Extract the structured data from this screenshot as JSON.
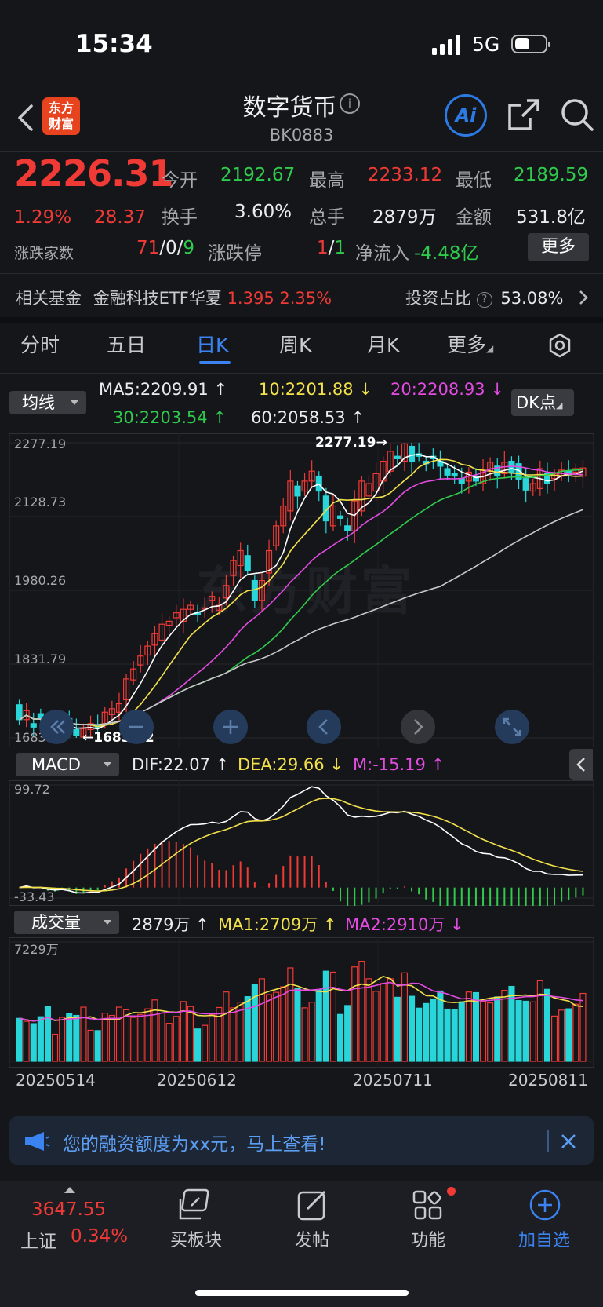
{
  "status_bar": {
    "time": "15:34",
    "network": "5G"
  },
  "header": {
    "logo_text": "东方\n财富",
    "title": "数字货币",
    "code": "BK0883",
    "ai_label": "Ai"
  },
  "quote": {
    "price": "2226.31",
    "change_pct": "1.29%",
    "change": "28.37",
    "open_label": "今开",
    "open": "2192.67",
    "high_label": "最高",
    "high": "2233.12",
    "low_label": "最低",
    "low": "2189.59",
    "turnover_label": "换手",
    "turnover": "3.60%",
    "volume_label": "总手",
    "volume": "2879万",
    "amount_label": "金额",
    "amount": "531.8亿",
    "breadth_label": "涨跌家数",
    "breadth_up": "71",
    "breadth_sep1": "/",
    "breadth_flat": "0",
    "breadth_sep2": "/",
    "breadth_down": "9",
    "limit_label": "涨跌停",
    "limit_up": "1",
    "limit_sep": "/",
    "limit_down": "1",
    "netflow_label": "净流入",
    "netflow": "-4.48亿",
    "more_label": "更多"
  },
  "fund": {
    "label": "相关基金",
    "name": "金融科技ETF华夏",
    "price": "1.395",
    "pct": "2.35%",
    "ratio_label": "投资占比",
    "ratio": "53.08%"
  },
  "tabs": [
    "分时",
    "五日",
    "日K",
    "周K",
    "月K",
    "更多"
  ],
  "ma_panel": {
    "selector": "均线",
    "ma5": "MA5:2209.91",
    "ma10": "10:2201.88",
    "ma20": "20:2208.93",
    "ma30": "30:2203.54",
    "ma60": "60:2058.53",
    "dk_label": "DK点"
  },
  "chart_data": [
    {
      "type": "candlestick",
      "title": "日K",
      "y_ticks": [
        "2277.19",
        "2128.73",
        "1980.26",
        "1831.79",
        "1683.32"
      ],
      "ylim": [
        1683.32,
        2277.19
      ],
      "annotations": [
        "2277.19",
        "1683.32"
      ],
      "x_ticks": [
        "20250514",
        "20250612",
        "20250711",
        "20250811"
      ],
      "candles_open": [
        1750,
        1720,
        1712,
        1732,
        1718,
        1700,
        1696,
        1722,
        1700,
        1685,
        1700,
        1708,
        1712,
        1730,
        1735,
        1760,
        1800,
        1830,
        1850,
        1870,
        1880,
        1910,
        1925,
        1918,
        1942,
        1935,
        1945,
        1960,
        1940,
        1965,
        2010,
        2030,
        2050,
        2000,
        1960,
        2015,
        2070,
        2110,
        2140,
        2190,
        2180,
        2200,
        2210,
        2170,
        2110,
        2130,
        2110,
        2100,
        2140,
        2170,
        2180,
        2200,
        2220,
        2250,
        2240,
        2270,
        2255,
        2240,
        2250,
        2240,
        2225,
        2215,
        2205,
        2200,
        2210,
        2195,
        2220,
        2230,
        2215,
        2240,
        2235,
        2205,
        2180,
        2185,
        2215,
        2205,
        2210,
        2220,
        2218,
        2210
      ],
      "candles_close": [
        1720,
        1738,
        1705,
        1722,
        1700,
        1706,
        1720,
        1700,
        1688,
        1702,
        1712,
        1704,
        1735,
        1742,
        1752,
        1802,
        1822,
        1848,
        1868,
        1893,
        1912,
        1918,
        1935,
        1942,
        1950,
        1932,
        1945,
        1968,
        1950,
        1990,
        2040,
        2060,
        2020,
        1960,
        2000,
        2060,
        2110,
        2150,
        2200,
        2170,
        2200,
        2220,
        2180,
        2120,
        2150,
        2125,
        2100,
        2160,
        2200,
        2195,
        2215,
        2240,
        2260,
        2245,
        2275,
        2240,
        2250,
        2235,
        2245,
        2230,
        2212,
        2210,
        2195,
        2218,
        2200,
        2222,
        2238,
        2210,
        2238,
        2218,
        2204,
        2182,
        2195,
        2225,
        2195,
        2215,
        2222,
        2213,
        2225,
        2226.31
      ],
      "ma_series": [
        {
          "name": "MA5",
          "value": 2209.91
        },
        {
          "name": "MA10",
          "value": 2201.88
        },
        {
          "name": "MA20",
          "value": 2208.93
        },
        {
          "name": "MA30",
          "value": 2203.54
        },
        {
          "name": "MA60",
          "value": 2058.53
        }
      ]
    },
    {
      "type": "macd",
      "label": "MACD",
      "dif": "DIF:22.07",
      "dea": "DEA:29.66",
      "m": "M:-15.19",
      "y_ticks": [
        "99.72",
        "-33.43"
      ],
      "ylim": [
        -33.43,
        99.72
      ]
    },
    {
      "type": "bar",
      "label": "成交量",
      "current": "2879万",
      "ma1": "MA1:2709万",
      "ma2": "MA2:2910万",
      "y_ticks": [
        "7229万"
      ],
      "ylim": [
        0,
        7229
      ]
    }
  ],
  "macd_selector": "MACD",
  "vol_selector": "成交量",
  "banner": {
    "text": "您的融资额度为xx元，马上查看!"
  },
  "bottom_nav": {
    "index_value": "3647.55",
    "index_name": "上证",
    "index_pct": "0.34%",
    "items": [
      "买板块",
      "发帖",
      "功能",
      "加自选"
    ]
  },
  "watermark": "东方财富"
}
